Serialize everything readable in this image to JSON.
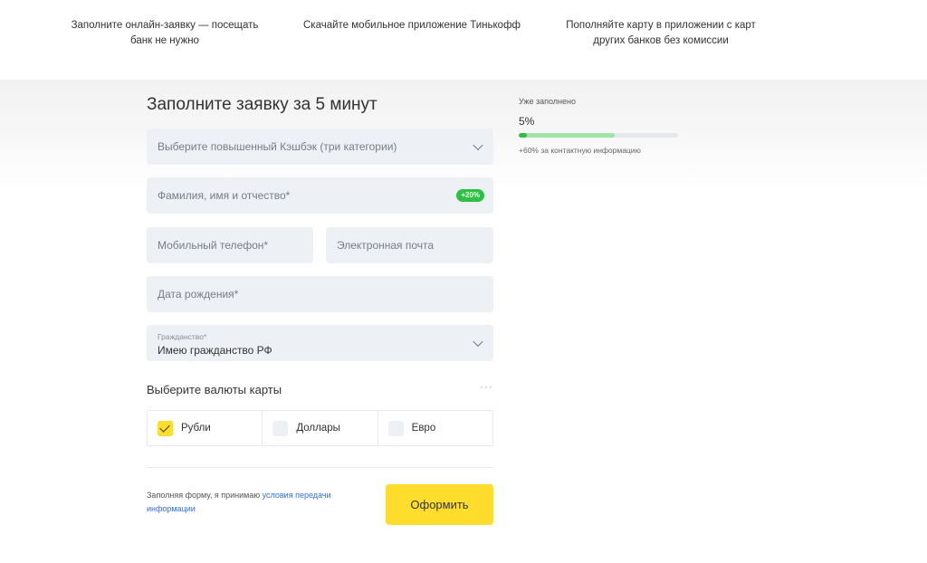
{
  "benefits": [
    {
      "text": "Заполните онлайн-заявку — посещать банк не нужно"
    },
    {
      "text": "Скачайте мобильное приложение Тинькофф"
    },
    {
      "text": "Пополняйте карту в приложении с карт других банков без комиссии"
    }
  ],
  "form": {
    "title": "Заполните заявку за 5 минут",
    "cashback_select": {
      "placeholder": "Выберите повышенный Кэшбэк (три категории)"
    },
    "full_name": {
      "placeholder": "Фамилия, имя и отчество*",
      "badge": "+20%"
    },
    "phone": {
      "placeholder": "Мобильный телефон*"
    },
    "email": {
      "placeholder": "Электронная почта"
    },
    "birth_date": {
      "placeholder": "Дата рождения*"
    },
    "citizenship": {
      "label": "Гражданство*",
      "value": "Имею гражданство РФ"
    },
    "currency_section": {
      "title": "Выберите валюты карты",
      "more": "···",
      "options": [
        {
          "label": "Рубли",
          "checked": true
        },
        {
          "label": "Доллары",
          "checked": false
        },
        {
          "label": "Евро",
          "checked": false
        }
      ]
    },
    "consent": {
      "text": "Заполняя форму, я принимаю ",
      "link": "условия передачи информации"
    },
    "submit_label": "Оформить"
  },
  "progress": {
    "label": "Уже заполнено",
    "value": "5%",
    "fraction": 0.05,
    "potential_fraction": 0.6,
    "hint": "+60% за контактную информацию",
    "colors": {
      "fill": "#2fbf44",
      "potential": "#9fe3a8",
      "track": "#e5e7eb"
    }
  },
  "colors": {
    "accent": "#ffdd2d",
    "field_bg": "#edf0f5",
    "link": "#336fee",
    "badge": "#2fbf44"
  }
}
